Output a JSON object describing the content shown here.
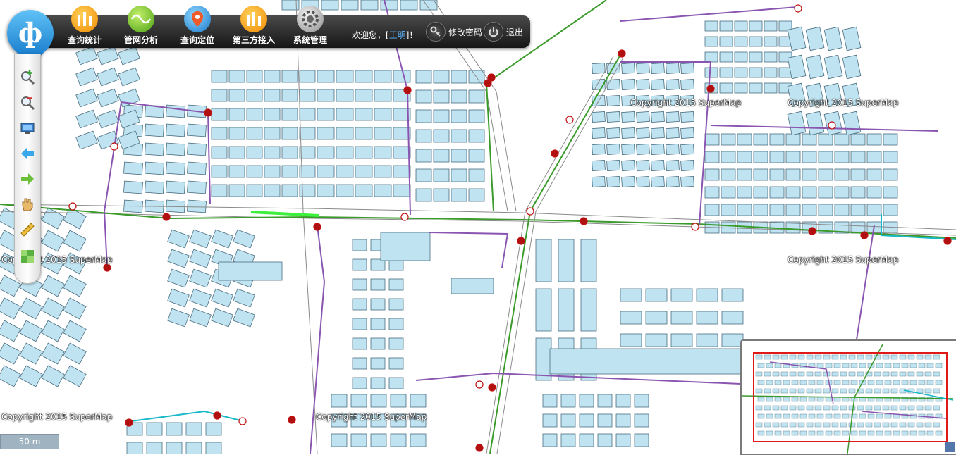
{
  "toolbar": {
    "buttons": [
      {
        "label": "查询统计",
        "icon": "bar-chart-icon"
      },
      {
        "label": "管网分析",
        "icon": "wave-analysis-icon"
      },
      {
        "label": "查询定位",
        "icon": "locate-pin-icon"
      },
      {
        "label": "第三方接入",
        "icon": "bar-chart-icon"
      },
      {
        "label": "系统管理",
        "icon": "gear-settings-icon"
      }
    ],
    "welcome_prefix": "欢迎您，[",
    "user_name": "王明",
    "welcome_suffix": "]！",
    "change_password": "修改密码",
    "logout": "退出"
  },
  "logo": {
    "text": "ф",
    "icon": "app-logo-icon"
  },
  "left_tools": [
    {
      "icon": "zoom-in-icon"
    },
    {
      "icon": "zoom-out-icon"
    },
    {
      "icon": "full-extent-icon"
    },
    {
      "icon": "back-arrow-icon"
    },
    {
      "icon": "forward-arrow-icon"
    },
    {
      "icon": "pan-hand-icon"
    },
    {
      "icon": "measure-ruler-icon"
    },
    {
      "icon": "layers-icon"
    }
  ],
  "map": {
    "copyright_text": "Copyright 2015 SuperMap",
    "scale_label": "50 m",
    "colors": {
      "building": "#bfe3f0",
      "building_edge": "#4a6e80",
      "road": "#8a8a8a",
      "pipe_green": "#3a9a2a",
      "pipe_purple": "#8a55b0",
      "pipe_cyan": "#17b8c8",
      "pipe_highlight": "#3cf03c",
      "overview_extent": "#e01818"
    }
  }
}
